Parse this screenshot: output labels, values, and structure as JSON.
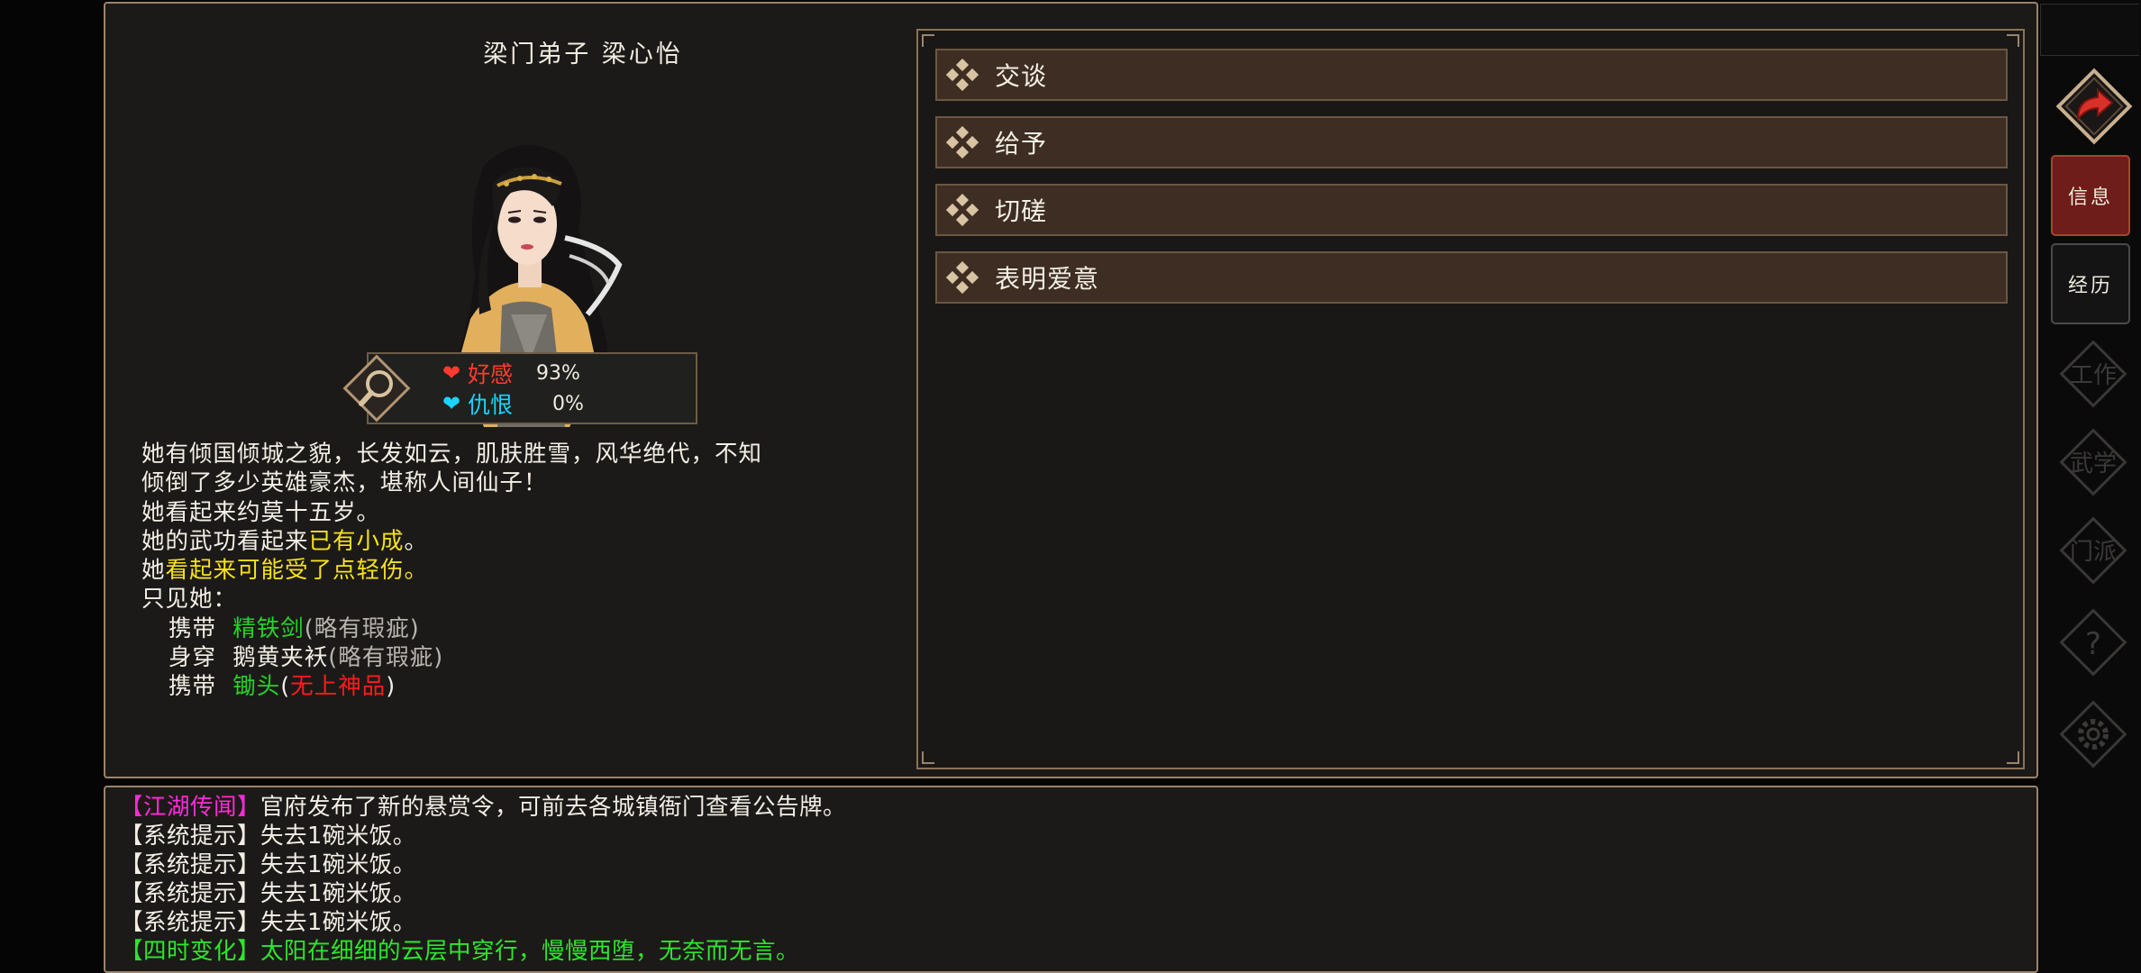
{
  "npc": {
    "title": "梁门弟子 梁心怡",
    "stats": {
      "affection_label": "好感",
      "affection_value": "93%",
      "hatred_label": "仇恨",
      "hatred_value": "0%"
    }
  },
  "description": {
    "line1": "她有倾国倾城之貌，长发如云，肌肤胜雪，风华绝代，不知",
    "line2": "倾倒了多少英雄豪杰，堪称人间仙子！",
    "line3": "她看起来约莫十五岁。",
    "line4_prefix": "她的武功看起来",
    "line4_highlight": "已有小成",
    "line4_suffix": "。",
    "line5_prefix": "她",
    "line5_highlight": "看起来可能受了点轻伤",
    "line5_suffix": "。",
    "line6": "只见她：",
    "equipment": [
      {
        "verb": "携带",
        "item": "精铁剑",
        "open": "(",
        "quality": "略有瑕疵",
        "close": ")"
      },
      {
        "verb": "身穿",
        "item": "鹅黄夹袄",
        "open": "(",
        "quality": "略有瑕疵",
        "close": ")"
      },
      {
        "verb": "携带",
        "item": "锄头",
        "open": "(",
        "quality": "无上神品",
        "close": ")"
      }
    ]
  },
  "options": [
    "交谈",
    "给予",
    "切磋",
    "表明爱意"
  ],
  "log": [
    {
      "tag": "【江湖传闻】",
      "text": "官府发布了新的悬赏令，可前去各城镇衙门查看公告牌。"
    },
    {
      "tag": "【系统提示】",
      "text": "失去1碗米饭。"
    },
    {
      "tag": "【系统提示】",
      "text": "失去1碗米饭。"
    },
    {
      "tag": "【系统提示】",
      "text": "失去1碗米饭。"
    },
    {
      "tag": "【系统提示】",
      "text": "失去1碗米饭。"
    },
    {
      "tag": "【四时变化】",
      "text": "太阳在细细的云层中穿行，慢慢西堕，无奈而无言。"
    }
  ],
  "side_menu": {
    "info_label": "信息",
    "history_label": "经历",
    "faded_labels": [
      "工作",
      "武学",
      "门派"
    ]
  },
  "colors": {
    "affection": "#ff3b2f",
    "hatred": "#19d4ff",
    "yellow": "#f6e21c",
    "green": "#27d22a",
    "grey": "#b8b4ae",
    "red": "#ff1b1b",
    "magenta": "#ff2bd6",
    "log_green": "#2ee62e"
  },
  "icons": {
    "option_icon": "four-diamond-icon",
    "back": "return-arrow-icon",
    "help": "question-icon",
    "settings": "gear-icon",
    "inspect": "magnifier-icon"
  }
}
